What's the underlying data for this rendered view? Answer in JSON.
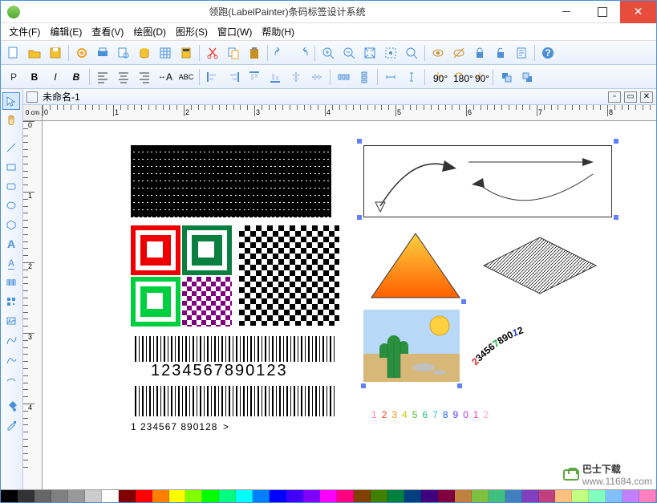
{
  "window": {
    "title": "领跑(LabelPainter)条码标签设计系统"
  },
  "menu": {
    "items": [
      "文件(F)",
      "编辑(E)",
      "查看(V)",
      "绘图(D)",
      "图形(S)",
      "窗口(W)",
      "帮助(H)"
    ]
  },
  "doc": {
    "name": "未命名-1",
    "unit": "0 cm"
  },
  "ruler": {
    "marks": [
      "0",
      "1",
      "2",
      "3",
      "4",
      "5",
      "6",
      "7",
      "8"
    ]
  },
  "vruler": {
    "marks": [
      "0",
      "1",
      "2",
      "3",
      "4"
    ]
  },
  "barcodes": {
    "num1": "1234567890123",
    "num2": "1  234567  890128",
    "suffix": ">"
  },
  "arcnum": "234567890",
  "rainbow": "1234567890123",
  "palette": [
    "#000000",
    "#333333",
    "#666666",
    "#808080",
    "#999999",
    "#cccccc",
    "#ffffff",
    "#800000",
    "#ff0000",
    "#ff8000",
    "#ffff00",
    "#80ff00",
    "#00ff00",
    "#00ff80",
    "#00ffff",
    "#0080ff",
    "#0000ff",
    "#4000ff",
    "#8000ff",
    "#ff00ff",
    "#ff0080",
    "#804000",
    "#408000",
    "#008040",
    "#004080",
    "#400080",
    "#800040",
    "#c08040",
    "#80c040",
    "#40c080",
    "#4080c0",
    "#8040c0",
    "#c04080",
    "#ffc080",
    "#c0ff80",
    "#80ffc0",
    "#80c0ff",
    "#c080ff",
    "#ff80c0"
  ],
  "watermark": {
    "brand": "巴士下载",
    "url": "www.11684.com"
  }
}
